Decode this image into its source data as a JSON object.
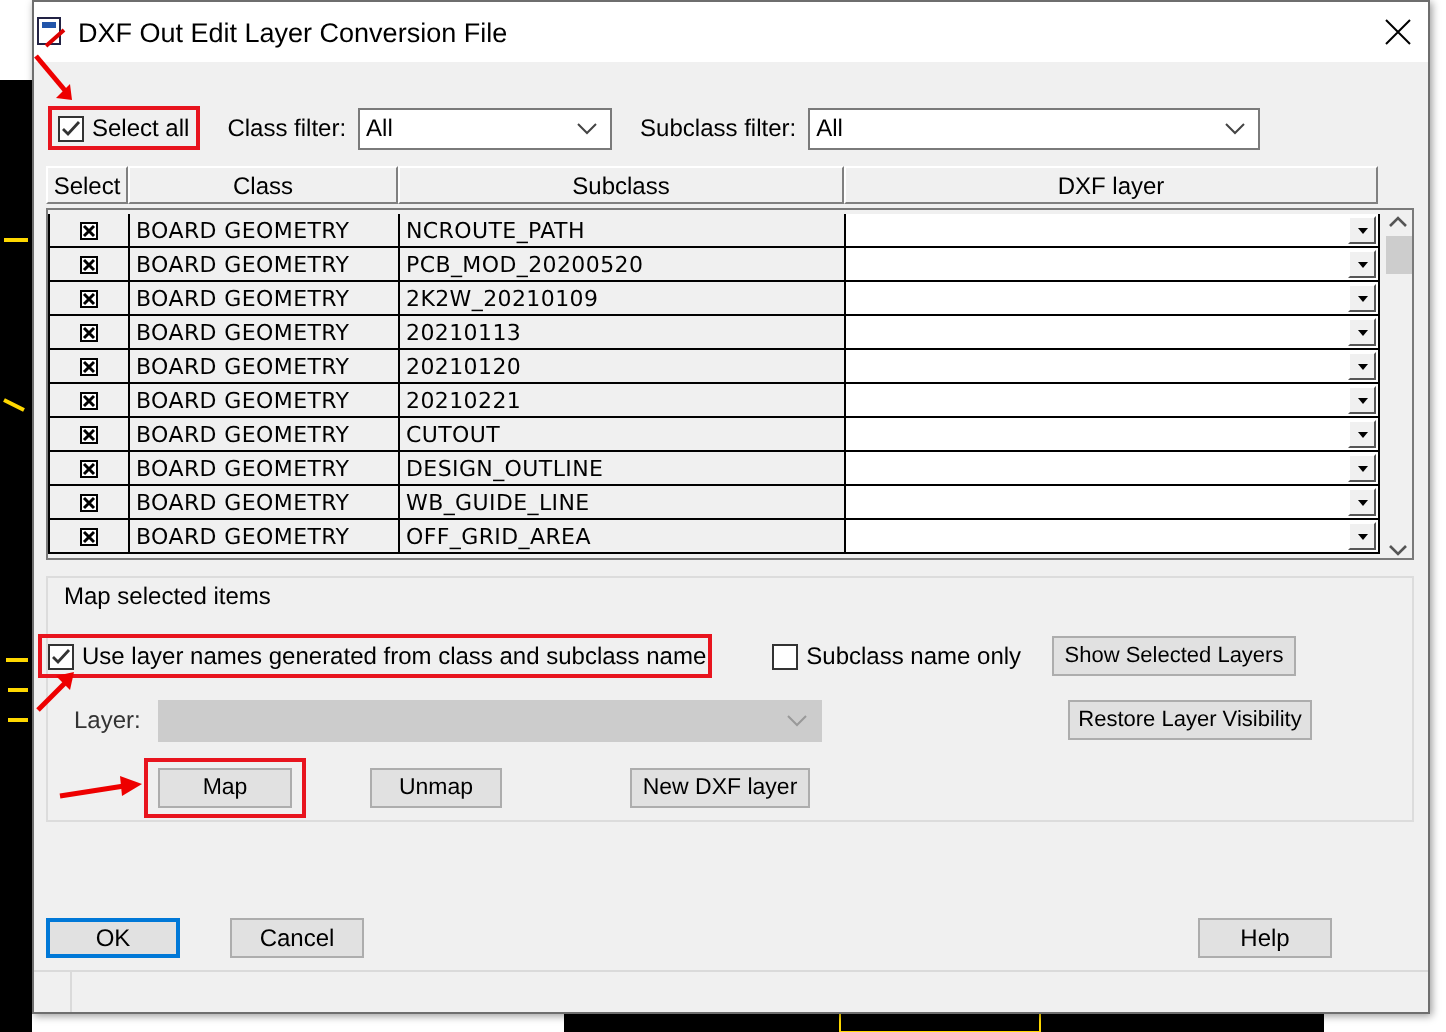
{
  "window": {
    "title": "DXF Out Edit Layer Conversion File"
  },
  "select_all": {
    "label": "Select all",
    "checked": true,
    "highlighted": true,
    "arrow": true
  },
  "filters": [
    {
      "label": "Class filter:",
      "value": "All"
    },
    {
      "label": "Subclass filter:",
      "value": "All"
    }
  ],
  "table": {
    "columns": [
      "Select",
      "Class",
      "Subclass",
      "DXF layer"
    ],
    "rows": [
      {
        "checked": true,
        "class": "BOARD GEOMETRY",
        "subclass": "NCROUTE_PATH"
      },
      {
        "checked": true,
        "class": "BOARD GEOMETRY",
        "subclass": "PCB_MOD_20200520"
      },
      {
        "checked": true,
        "class": "BOARD GEOMETRY",
        "subclass": "2K2W_20210109"
      },
      {
        "checked": true,
        "class": "BOARD GEOMETRY",
        "subclass": "20210113"
      },
      {
        "checked": true,
        "class": "BOARD GEOMETRY",
        "subclass": "20210120"
      },
      {
        "checked": true,
        "class": "BOARD GEOMETRY",
        "subclass": "20210221"
      },
      {
        "checked": true,
        "class": "BOARD GEOMETRY",
        "subclass": "CUTOUT"
      },
      {
        "checked": true,
        "class": "BOARD GEOMETRY",
        "subclass": "DESIGN_OUTLINE"
      },
      {
        "checked": true,
        "class": "BOARD GEOMETRY",
        "subclass": "WB_GUIDE_LINE"
      },
      {
        "checked": true,
        "class": "BOARD GEOMETRY",
        "subclass": "OFF_GRID_AREA"
      }
    ]
  },
  "map_group": {
    "title": "Map selected items",
    "options": [
      {
        "label": "Use layer names generated from class and subclass name",
        "checked": true,
        "highlighted": true,
        "arrow": true
      },
      {
        "label": "Subclass name only",
        "checked": false,
        "highlighted": false,
        "arrow": false
      }
    ],
    "layer": {
      "label": "Layer:",
      "disabled": true
    },
    "buttons": [
      {
        "label": "Map",
        "highlighted": true,
        "arrow": true
      },
      {
        "label": "Unmap",
        "highlighted": false,
        "arrow": false
      },
      {
        "label": "New DXF layer",
        "highlighted": false,
        "arrow": false
      }
    ],
    "side_buttons": [
      "Show Selected Layers",
      "Restore Layer Visibility"
    ]
  },
  "footer_buttons": [
    {
      "label": "OK",
      "default": true
    },
    {
      "label": "Cancel",
      "default": false
    },
    {
      "label": "Help",
      "default": false
    }
  ]
}
